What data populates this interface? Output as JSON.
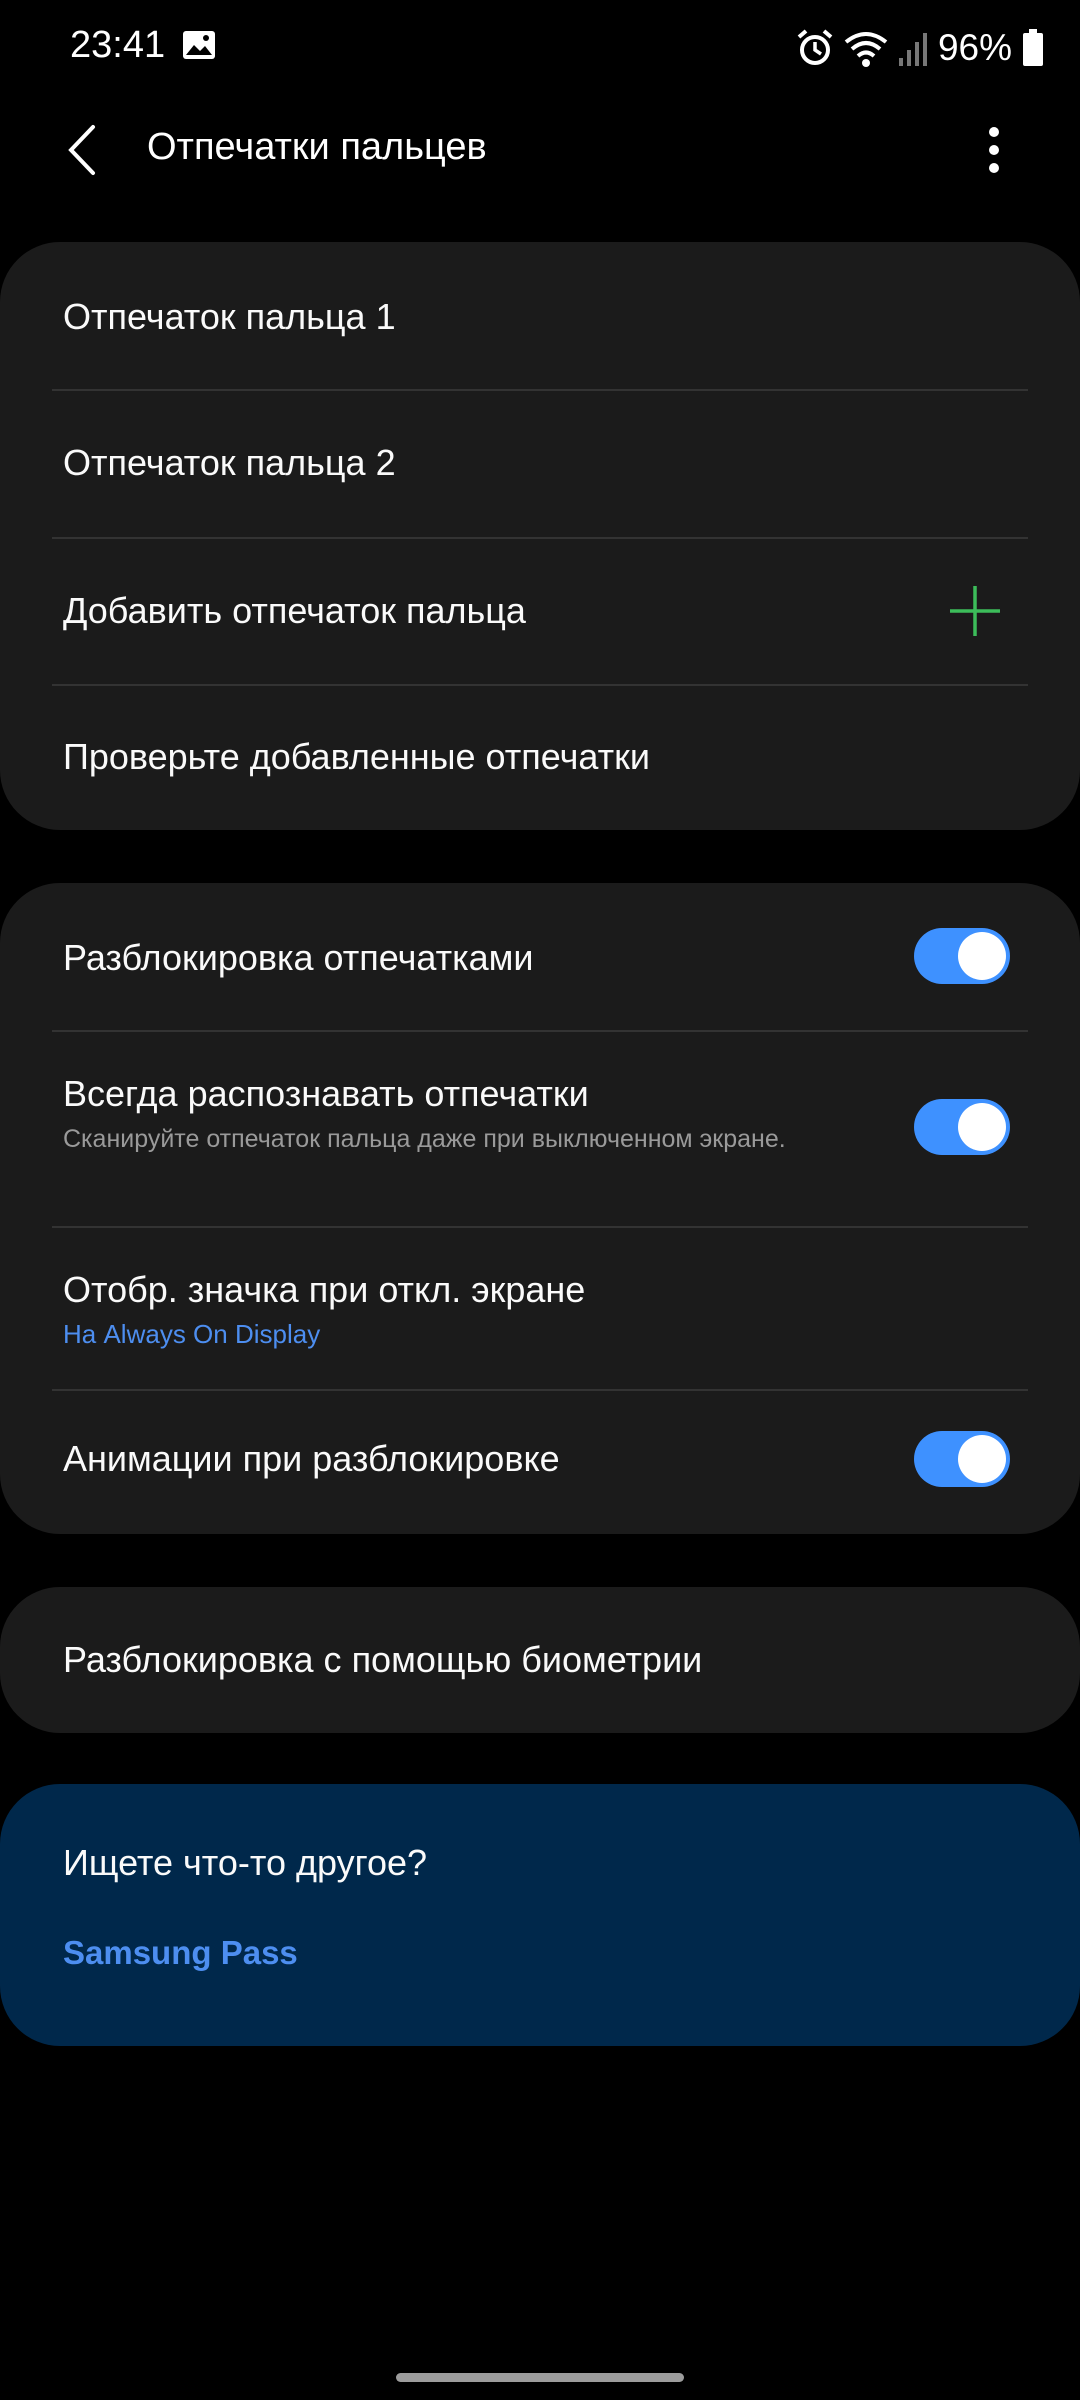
{
  "status_bar": {
    "time": "23:41",
    "battery": "96%",
    "icons": [
      "gallery-icon",
      "alarm-icon",
      "wifi-icon",
      "signal-icon",
      "battery-icon"
    ]
  },
  "header": {
    "title": "Отпечатки пальцев",
    "back_icon": "back-arrow-icon",
    "more_icon": "more-vert-icon"
  },
  "fingerprints": {
    "items": [
      {
        "label": "Отпечаток пальца 1"
      },
      {
        "label": "Отпечаток пальца 2"
      },
      {
        "label": "Добавить отпечаток пальца",
        "icon": "plus-icon"
      },
      {
        "label": "Проверьте добавленные отпечатки"
      }
    ]
  },
  "settings": {
    "unlock": {
      "label": "Разблокировка отпечатками",
      "enabled": true
    },
    "always_on": {
      "label": "Всегда распознавать отпечатки",
      "description": "Сканируйте отпечаток пальца даже при выключенном экране.",
      "enabled": true
    },
    "show_icon": {
      "label": "Отобр. значка при откл. экране",
      "value": "На Always On Display"
    },
    "animation": {
      "label": "Анимации при разблокировке",
      "enabled": true
    }
  },
  "biometrics": {
    "label": "Разблокировка с помощью биометрии"
  },
  "help": {
    "title": "Ищете что-то другое?",
    "link": "Samsung Pass"
  },
  "colors": {
    "accent": "#3e91ff",
    "link": "#4d8ef0",
    "add_icon": "#3cbd5a",
    "card": "#1b1b1b",
    "help_card": "#00284b"
  }
}
